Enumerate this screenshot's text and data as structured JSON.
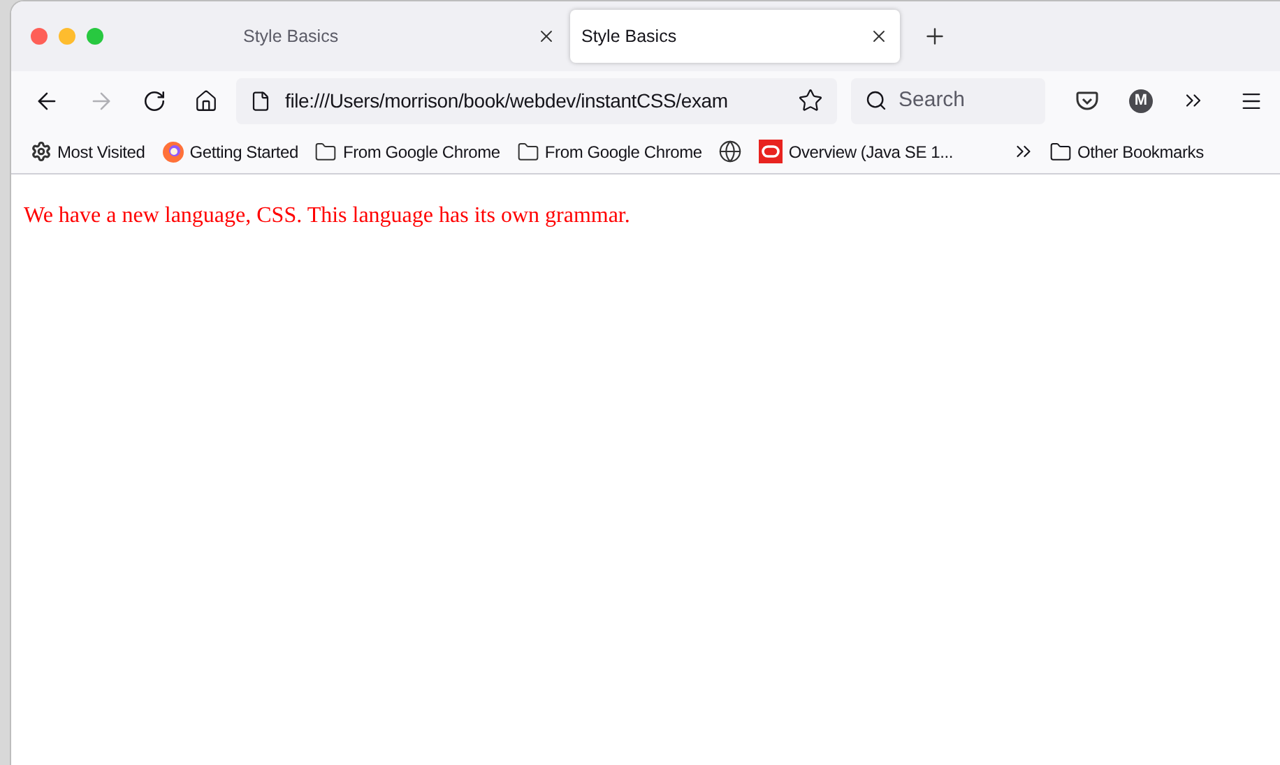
{
  "tabs": [
    {
      "title": "Style Basics",
      "selected": false
    },
    {
      "title": "Style Basics",
      "selected": true
    }
  ],
  "toolbar": {
    "url": "file:///Users/morrison/book/webdev/instantCSS/exam",
    "search": {
      "placeholder": "Search"
    },
    "account_initial": "M"
  },
  "bookmarks": [
    {
      "kind": "gear",
      "label": "Most Visited"
    },
    {
      "kind": "firefox",
      "label": "Getting Started"
    },
    {
      "kind": "folder",
      "label": "From Google Chrome"
    },
    {
      "kind": "folder",
      "label": "From Google Chrome"
    },
    {
      "kind": "globe"
    },
    {
      "kind": "oracle",
      "label": "Overview (Java SE 1..."
    }
  ],
  "other_bookmarks": "Other Bookmarks",
  "page": {
    "text": "We have a new language, CSS. This language has its own grammar."
  }
}
